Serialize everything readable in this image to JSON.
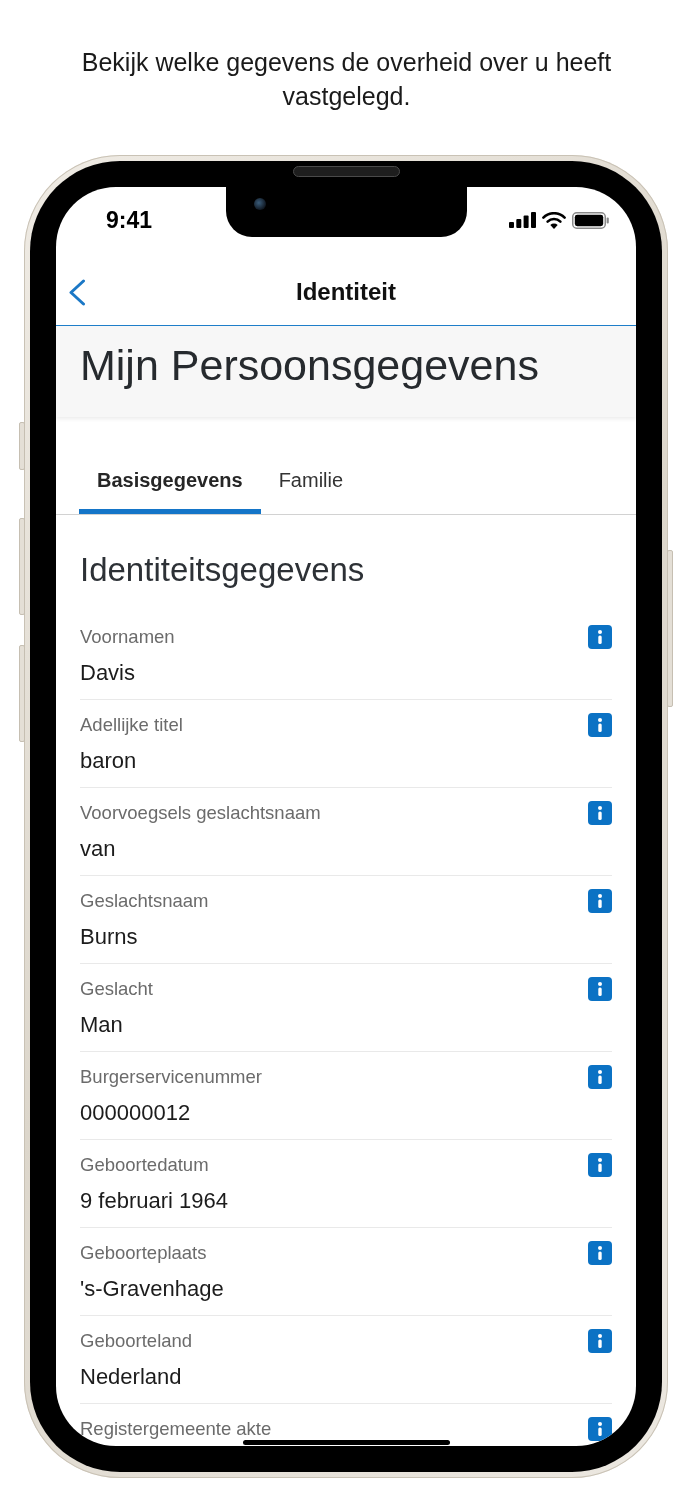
{
  "caption": "Bekijk welke gegevens de overheid over u heeft vastgelegd.",
  "status_bar": {
    "time": "9:41"
  },
  "nav_bar": {
    "title": "Identiteit"
  },
  "page_title": "Mijn Persoonsgegevens",
  "tabs": [
    {
      "label": "Basisgegevens",
      "selected": true
    },
    {
      "label": "Familie",
      "selected": false
    }
  ],
  "section": {
    "title": "Identiteitsgegevens",
    "fields": [
      {
        "label": "Voornamen",
        "value": "Davis"
      },
      {
        "label": "Adellijke titel",
        "value": "baron"
      },
      {
        "label": "Voorvoegsels geslachtsnaam",
        "value": "van"
      },
      {
        "label": "Geslachtsnaam",
        "value": "Burns"
      },
      {
        "label": "Geslacht",
        "value": "Man"
      },
      {
        "label": "Burgerservicenummer",
        "value": "000000012"
      },
      {
        "label": "Geboortedatum",
        "value": "9 februari 1964"
      },
      {
        "label": "Geboorteplaats",
        "value": "'s-Gravenhage"
      },
      {
        "label": "Geboorteland",
        "value": "Nederland"
      },
      {
        "label": "Registergemeente akte"
      }
    ]
  }
}
